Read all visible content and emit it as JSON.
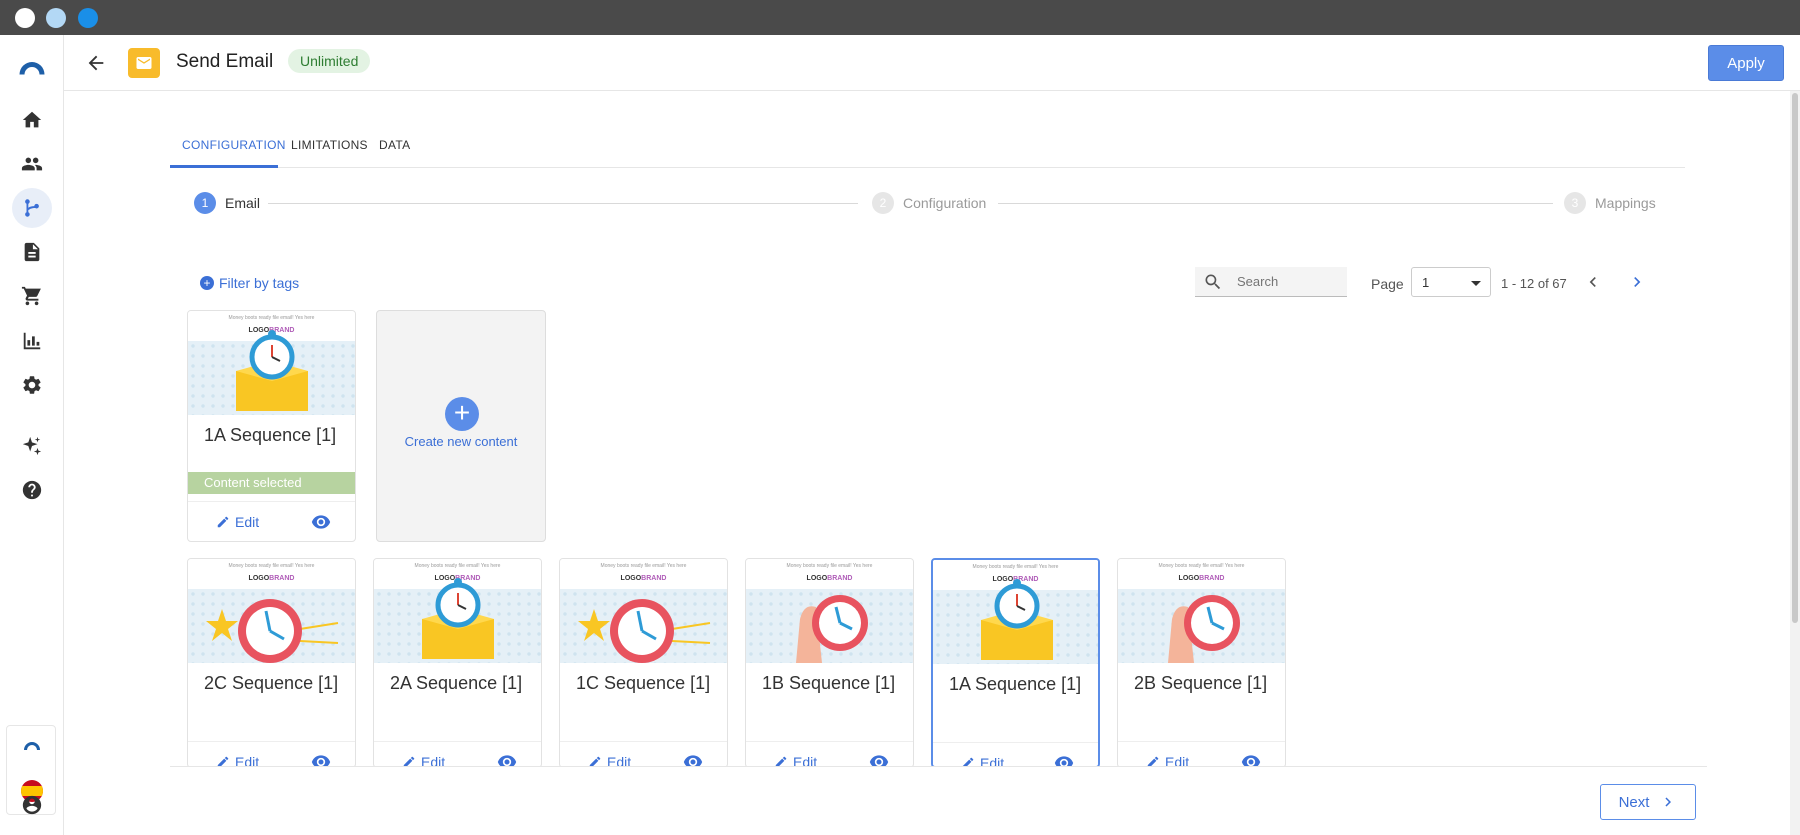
{
  "window": {
    "dots": [
      "#ffffff",
      "#b3d8f5",
      "#1a8fe8"
    ]
  },
  "sidebar": {
    "items": [
      "logo-icon",
      "home-icon",
      "people-icon",
      "flow-icon",
      "document-icon",
      "cart-icon",
      "bar-chart-icon",
      "gear-icon",
      "sparkle-icon",
      "help-icon"
    ],
    "active": "flow-icon",
    "bottom": [
      "connectif-logo-icon",
      "spain-flag-icon",
      "account-icon"
    ]
  },
  "header": {
    "title": "Send Email",
    "badge": "Unlimited",
    "apply_label": "Apply"
  },
  "tabs": [
    {
      "label": "CONFIGURATION",
      "active": true
    },
    {
      "label": "LIMITATIONS",
      "active": false
    },
    {
      "label": "DATA",
      "active": false
    }
  ],
  "stepper": [
    {
      "num": "1",
      "label": "Email",
      "state": "done"
    },
    {
      "num": "2",
      "label": "Configuration",
      "state": "pending"
    },
    {
      "num": "3",
      "label": "Mappings",
      "state": "pending"
    }
  ],
  "toolbar": {
    "filter_label": "Filter by tags",
    "search_placeholder": "Search",
    "page_label": "Page",
    "page_value": "1",
    "range": "1 - 12 of 67"
  },
  "thumb": {
    "tiny": "Money boots ready file email! Yes here",
    "logo_a": "LOGO",
    "logo_b": "BRAND"
  },
  "selected_card": {
    "title": "1A Sequence [1]",
    "selected_label": "Content selected",
    "edit_label": "Edit"
  },
  "create": {
    "label": "Create new content"
  },
  "cards": [
    {
      "title": "2C Sequence [1]",
      "illus": "clock-burst",
      "edit_label": "Edit"
    },
    {
      "title": "2A Sequence [1]",
      "illus": "clock-box",
      "edit_label": "Edit"
    },
    {
      "title": "1C Sequence [1]",
      "illus": "clock-burst",
      "edit_label": "Edit"
    },
    {
      "title": "1B Sequence [1]",
      "illus": "clock-hand",
      "edit_label": "Edit"
    },
    {
      "title": "1A Sequence [1]",
      "illus": "clock-box",
      "edit_label": "Edit",
      "highlight": true
    },
    {
      "title": "2B Sequence [1]",
      "illus": "clock-hand",
      "edit_label": "Edit"
    }
  ],
  "footer": {
    "next_label": "Next"
  },
  "colors": {
    "accent": "#5b8de8",
    "selected_green": "#b7d3a0",
    "badge_bg": "#e3f3e3",
    "mail_yellow": "#f8bb2b"
  }
}
